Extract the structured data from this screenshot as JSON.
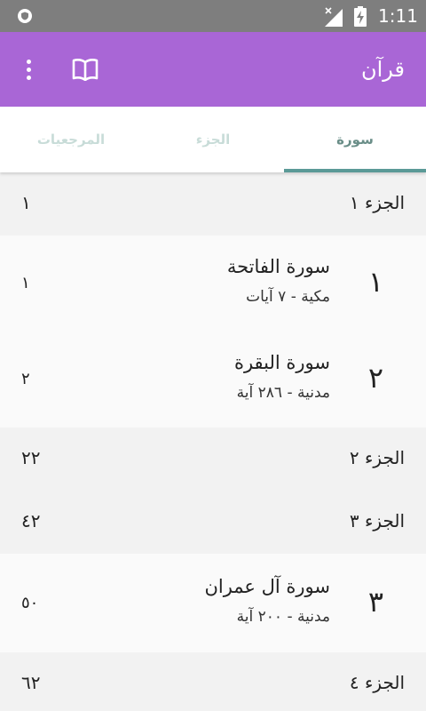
{
  "status_bar": {
    "time": "1:11",
    "icons": [
      "shield-icon",
      "signal-icon",
      "battery-charging-icon"
    ]
  },
  "app_bar": {
    "title": "قرآن",
    "icons": [
      "book-icon",
      "more-vert-icon"
    ]
  },
  "tabs": [
    {
      "label": "سورة",
      "selected": true
    },
    {
      "label": "الجزء",
      "selected": false
    },
    {
      "label": "المرجعيات",
      "selected": false
    }
  ],
  "list": [
    {
      "type": "juz",
      "label": "الجزء ١",
      "page": "١"
    },
    {
      "type": "surah",
      "number": "١",
      "name": "سورة الفاتحة",
      "info": "مكية - ٧ آيات",
      "page": "١"
    },
    {
      "type": "surah",
      "number": "٢",
      "name": "سورة البقرة",
      "info": "مدنية - ٢٨٦ آية",
      "page": "٢"
    },
    {
      "type": "juz",
      "label": "الجزء ٢",
      "page": "٢٢"
    },
    {
      "type": "juz",
      "label": "الجزء ٣",
      "page": "٤٢"
    },
    {
      "type": "surah",
      "number": "٣",
      "name": "سورة آل عمران",
      "info": "مدنية - ٢٠٠ آية",
      "page": "٥٠"
    },
    {
      "type": "juz",
      "label": "الجزء ٤",
      "page": "٦٢"
    }
  ],
  "colors": {
    "app_bar": "#a966d6",
    "status_bar": "#7e7e7e",
    "tab_selected": "#6a8e88",
    "tab_unselected": "#c8dcd8",
    "tab_indicator": "#5b9a97",
    "juz_row_bg": "#f2f2f2",
    "surah_row_bg": "#fafafa"
  }
}
